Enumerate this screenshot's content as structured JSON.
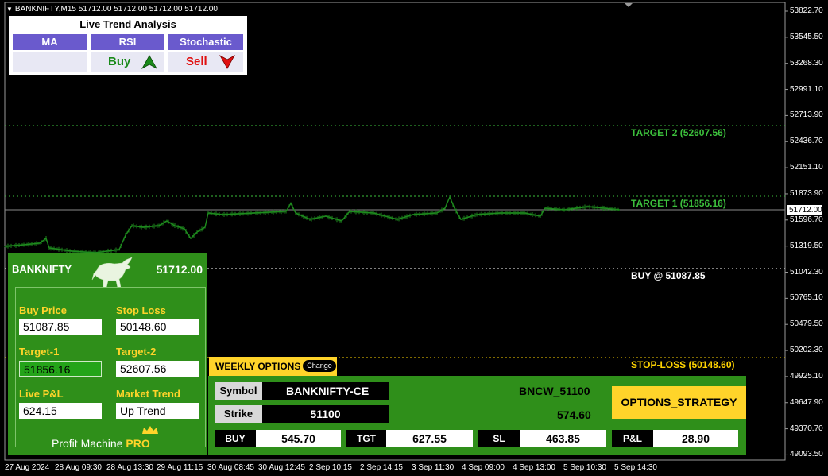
{
  "chart": {
    "title": "BANKNIFTY,M15  51712.00 51712.00 51712.00 51712.00",
    "price_labels": [
      "53822.70",
      "53545.50",
      "53268.30",
      "52991.10",
      "52713.90",
      "52436.70",
      "52151.10",
      "51873.90",
      "51596.70",
      "51319.50",
      "51042.30",
      "50765.10",
      "50479.50",
      "50202.30",
      "49925.10",
      "49647.90",
      "49370.70",
      "49093.50"
    ],
    "current_price": "51712.00",
    "time_labels": [
      "27 Aug 2024",
      "28 Aug 09:30",
      "28 Aug 13:30",
      "29 Aug 11:15",
      "30 Aug 08:45",
      "30 Aug 12:45",
      "2 Sep 10:15",
      "2 Sep 14:15",
      "3 Sep 11:30",
      "4 Sep 09:00",
      "4 Sep 13:00",
      "5 Sep 10:30",
      "5 Sep 14:30"
    ],
    "levels": {
      "target2": "TARGET 2 (52607.56)",
      "target1": "TARGET 1 (51856.16)",
      "buy": "BUY @ 51087.85",
      "stoploss": "STOP-LOSS (50148.60)"
    },
    "colors": {
      "candle": "#1e8c1e",
      "target": "#3cc03c",
      "buy": "#ffffff",
      "stoploss": "#ffd400"
    }
  },
  "trend": {
    "title": "Live Trend Analysis",
    "headers": [
      "MA",
      "RSI",
      "Stochastic"
    ],
    "rsi_signal": "Buy",
    "stoch_signal": "Sell"
  },
  "info": {
    "symbol": "BANKNIFTY",
    "price": "51712.00",
    "buy_price_label": "Buy Price",
    "buy_price": "51087.85",
    "stop_loss_label": "Stop Loss",
    "stop_loss": "50148.60",
    "target1_label": "Target-1",
    "target1": "51856.16",
    "target2_label": "Target-2",
    "target2": "52607.56",
    "pnl_label": "Live P&L",
    "pnl": "624.15",
    "trend_label": "Market Trend",
    "trend": "Up Trend",
    "brand_main": "Profit Machine",
    "brand_pro": "PRO"
  },
  "weekly": {
    "tab_label": "WEEKLY OPTIONS",
    "change_label": "Change",
    "symbol_key": "Symbol",
    "symbol_value": "BANKNIFTY-CE",
    "strike_key": "Strike",
    "strike_value": "51100",
    "contract": "BNCW_51100",
    "contract_price": "574.60",
    "strategy_label": "OPTIONS_STRATEGY",
    "buy_key": "BUY",
    "buy_value": "545.70",
    "tgt_key": "TGT",
    "tgt_value": "627.55",
    "sl_key": "SL",
    "sl_value": "463.85",
    "pnl_key": "P&L",
    "pnl_value": "28.90"
  }
}
